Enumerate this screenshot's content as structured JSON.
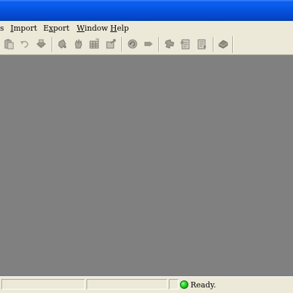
{
  "titlebar": {
    "color": "#0550dc"
  },
  "menu": {
    "items": [
      {
        "label": "s",
        "accel": "",
        "rest": "s",
        "visible_partial": true
      },
      {
        "label": "Import",
        "accel": "I",
        "rest": "mport"
      },
      {
        "label": "Export",
        "accel": "x",
        "pre": "E",
        "rest": "port"
      },
      {
        "label": "Window",
        "accel": "W",
        "rest": "indow"
      },
      {
        "label": "Help",
        "accel": "H",
        "rest": "elp"
      }
    ]
  },
  "toolbar": {
    "buttons": [
      {
        "icon": "paste-icon"
      },
      {
        "icon": "undo-icon"
      },
      {
        "icon": "print-icon"
      },
      {
        "icon": "bucket-icon"
      },
      {
        "icon": "hand-icon"
      },
      {
        "icon": "table-icon"
      },
      {
        "icon": "export-page-icon"
      },
      {
        "icon": "refresh-icon"
      },
      {
        "icon": "play-icon"
      },
      {
        "icon": "puzzle-icon"
      },
      {
        "icon": "document-icon"
      },
      {
        "icon": "document-list-icon"
      },
      {
        "icon": "book-icon"
      }
    ]
  },
  "statusbar": {
    "status_text": "Ready.",
    "status_color": "#22d422"
  }
}
